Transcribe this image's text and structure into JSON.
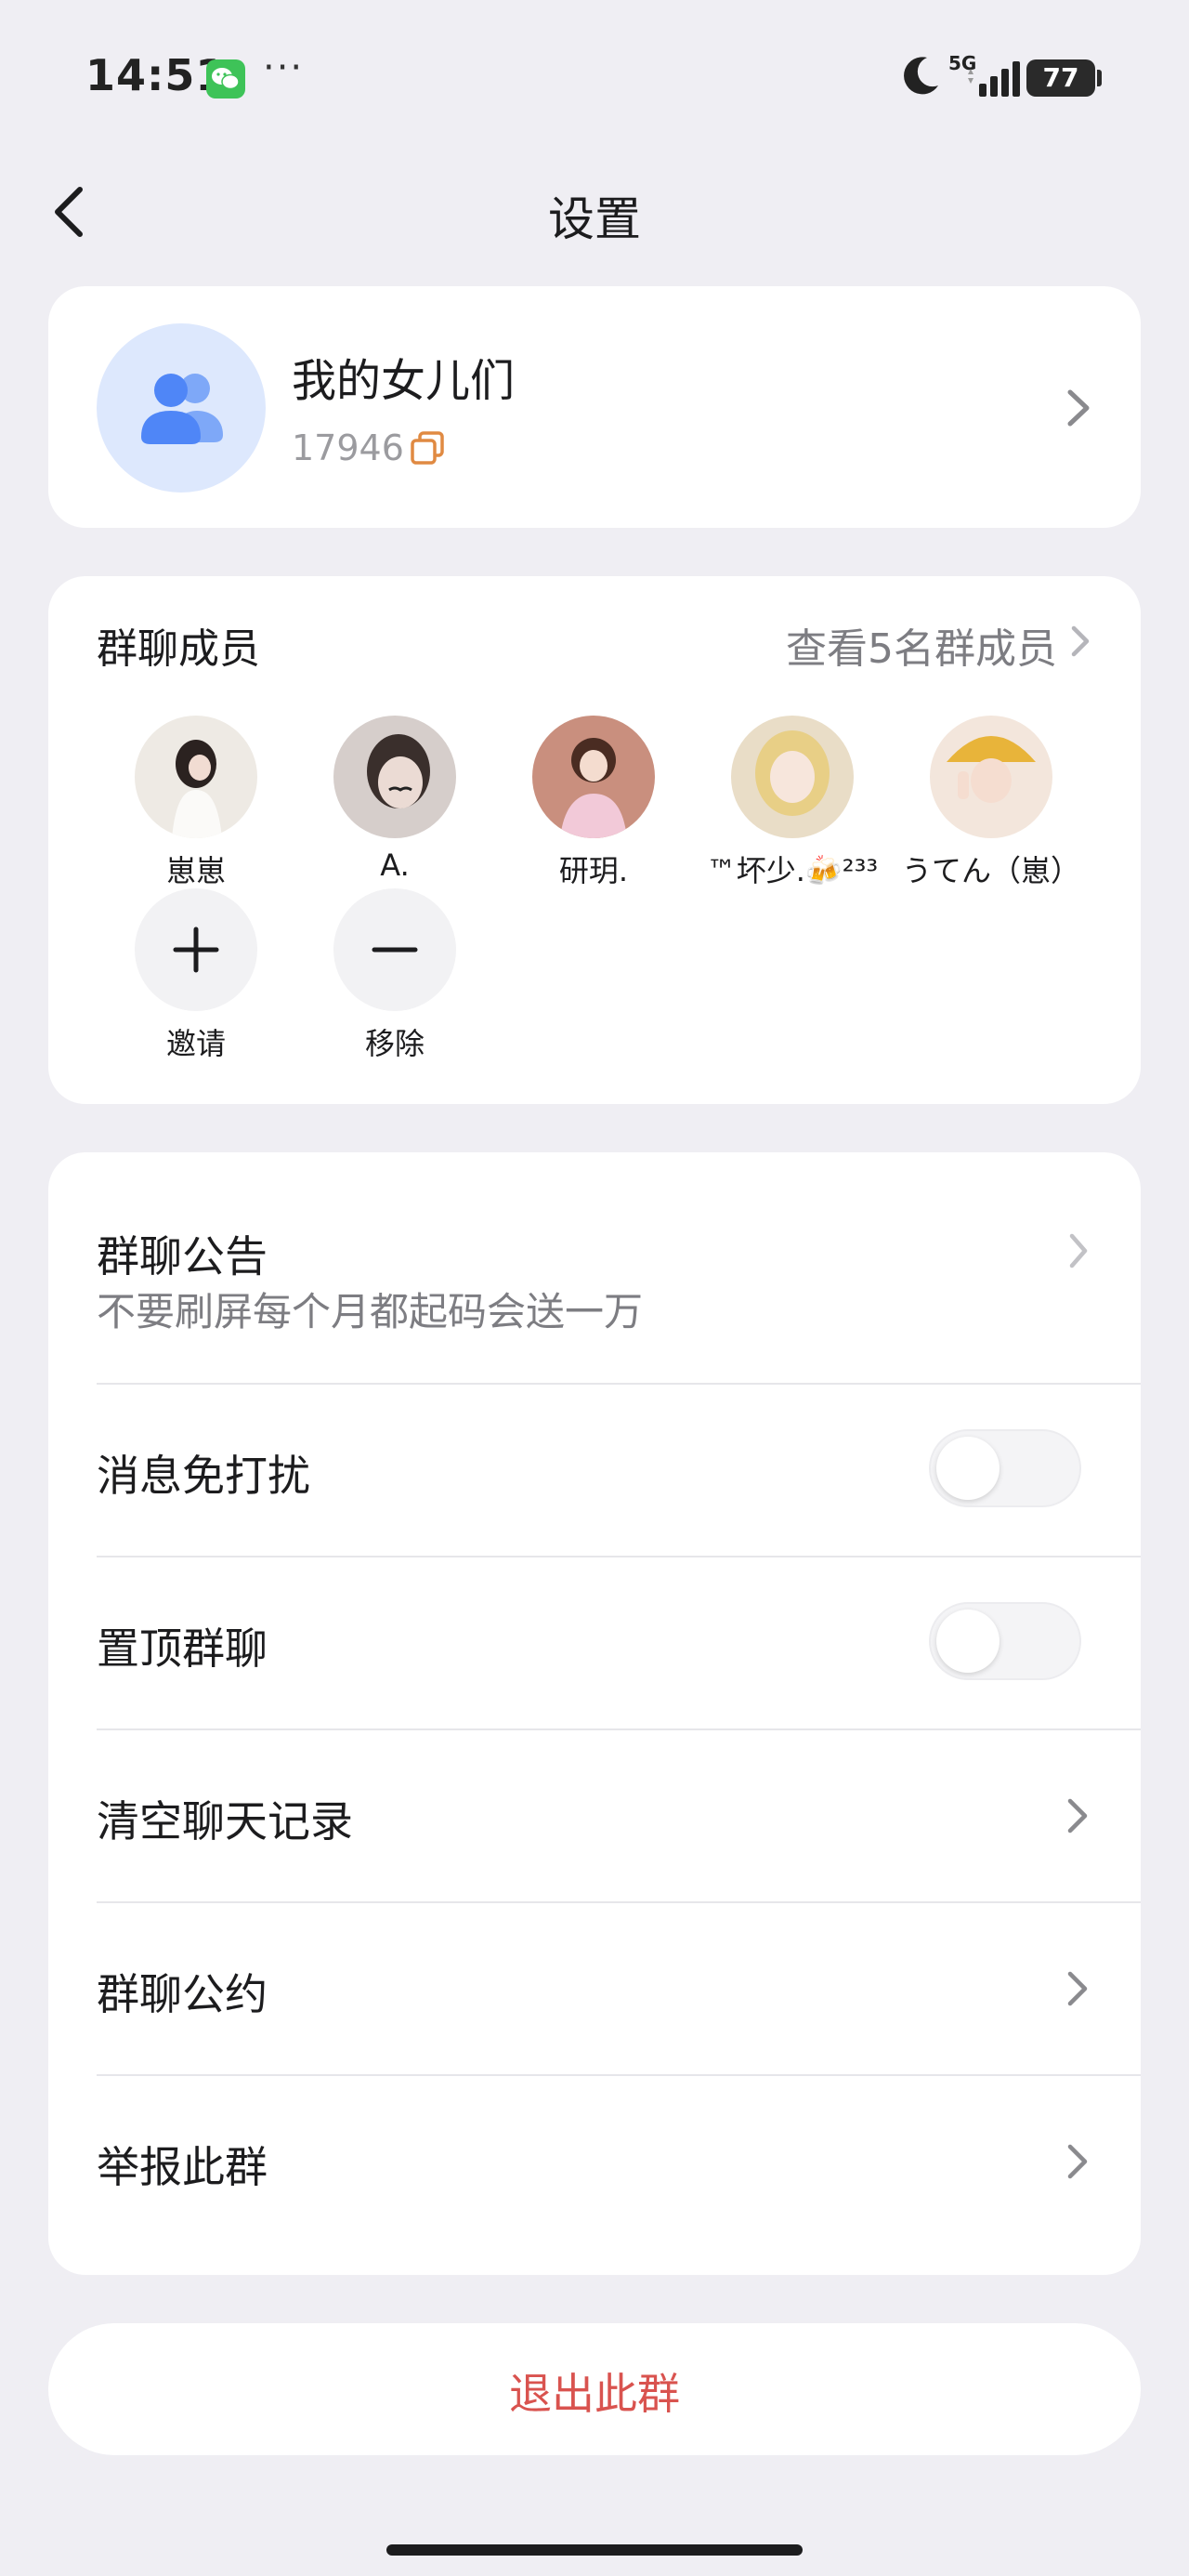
{
  "status_bar": {
    "time": "14:51",
    "dots": "···",
    "network": "5G",
    "battery": "77"
  },
  "nav": {
    "title": "设置"
  },
  "group": {
    "name": "我的女儿们",
    "id": "17946",
    "avatar_color": "#dde8fd",
    "icon_color": "#4f86f7"
  },
  "members": {
    "title": "群聊成员",
    "view_all": "查看5名群成员",
    "list": [
      {
        "name": "崽崽",
        "avatar_colors": [
          "#f0eeea",
          "#2b2220"
        ]
      },
      {
        "name": "A.",
        "avatar_colors": [
          "#d9d2cf",
          "#3a2f2c"
        ]
      },
      {
        "name": "研玥.",
        "avatar_colors": [
          "#c98f7e",
          "#f2c9d8"
        ]
      },
      {
        "name": "™坏少.🍻²³³",
        "avatar_colors": [
          "#e8cf86",
          "#f4e4c6"
        ]
      },
      {
        "name": "うてん（崽）",
        "avatar_colors": [
          "#e8b43a",
          "#f3e6dc"
        ]
      }
    ],
    "actions": [
      {
        "name": "邀请",
        "icon": "plus-icon"
      },
      {
        "name": "移除",
        "icon": "minus-icon"
      }
    ]
  },
  "settings": {
    "announcement": {
      "label": "群聊公告",
      "text": "不要刷屏每个月都起码会送一万"
    },
    "mute": {
      "label": "消息免打扰",
      "on": false
    },
    "pin": {
      "label": "置顶群聊",
      "on": false
    },
    "clear": {
      "label": "清空聊天记录"
    },
    "rules": {
      "label": "群聊公约"
    },
    "report": {
      "label": "举报此群"
    }
  },
  "exit": {
    "label": "退出此群",
    "color": "#d9534f"
  }
}
